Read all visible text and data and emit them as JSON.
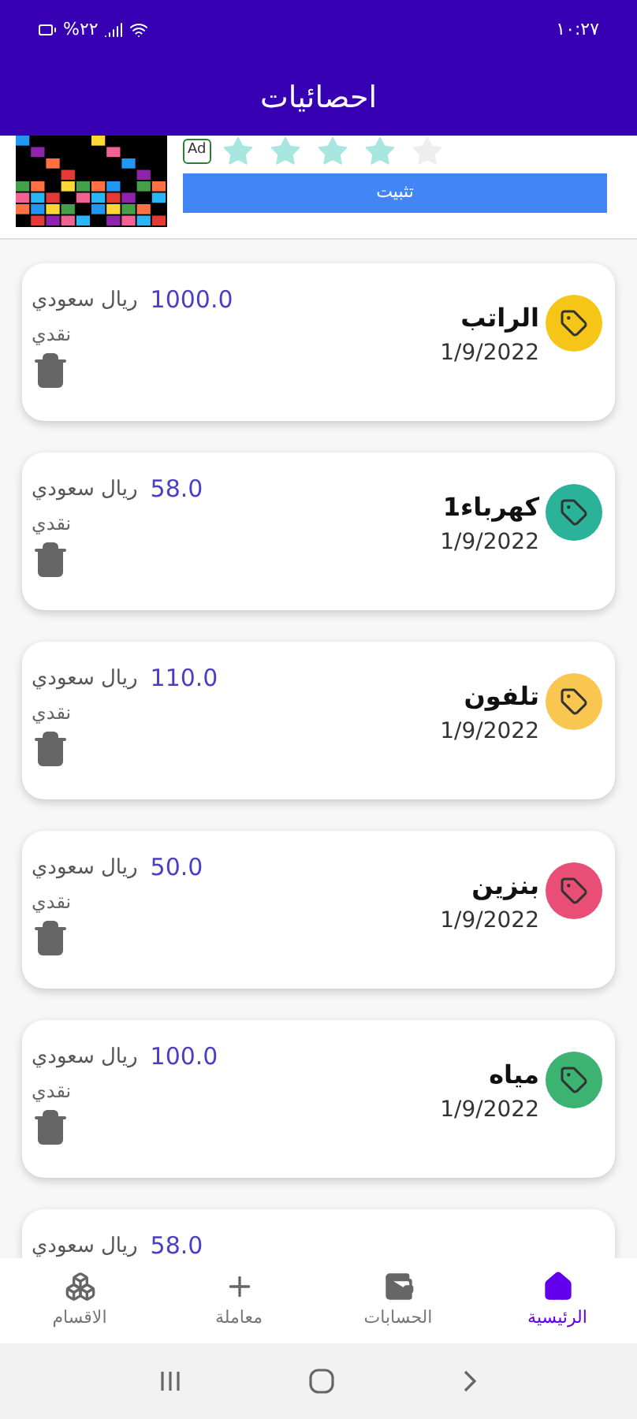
{
  "status_bar": {
    "time": "١٠:٢٧",
    "battery": "%٢٢"
  },
  "header": {
    "title": "احصائيات"
  },
  "ad": {
    "badge": "Ad",
    "stars": 4,
    "install_button": "تثبيت"
  },
  "transactions": [
    {
      "title": "الراتب",
      "date": "1/9/2022",
      "amount": "1000.0",
      "currency": "ريال سعودي",
      "payment": "نقدي",
      "color": "#f5c518"
    },
    {
      "title": "كهرباء1",
      "date": "1/9/2022",
      "amount": "58.0",
      "currency": "ريال سعودي",
      "payment": "نقدي",
      "color": "#2bb39a"
    },
    {
      "title": "تلفون",
      "date": "1/9/2022",
      "amount": "110.0",
      "currency": "ريال سعودي",
      "payment": "نقدي",
      "color": "#f9c74f"
    },
    {
      "title": "بنزين",
      "date": "1/9/2022",
      "amount": "50.0",
      "currency": "ريال سعودي",
      "payment": "نقدي",
      "color": "#e94e77"
    },
    {
      "title": "مياه",
      "date": "1/9/2022",
      "amount": "100.0",
      "currency": "ريال سعودي",
      "payment": "نقدي",
      "color": "#3cb371"
    },
    {
      "amount": "58.0",
      "currency": "ريال سعودي"
    }
  ],
  "bottom_nav": [
    {
      "label": "الرئيسية",
      "selected": true
    },
    {
      "label": "الحسابات",
      "selected": false
    },
    {
      "label": "معاملة",
      "selected": false
    },
    {
      "label": "الاقسام",
      "selected": false
    }
  ]
}
